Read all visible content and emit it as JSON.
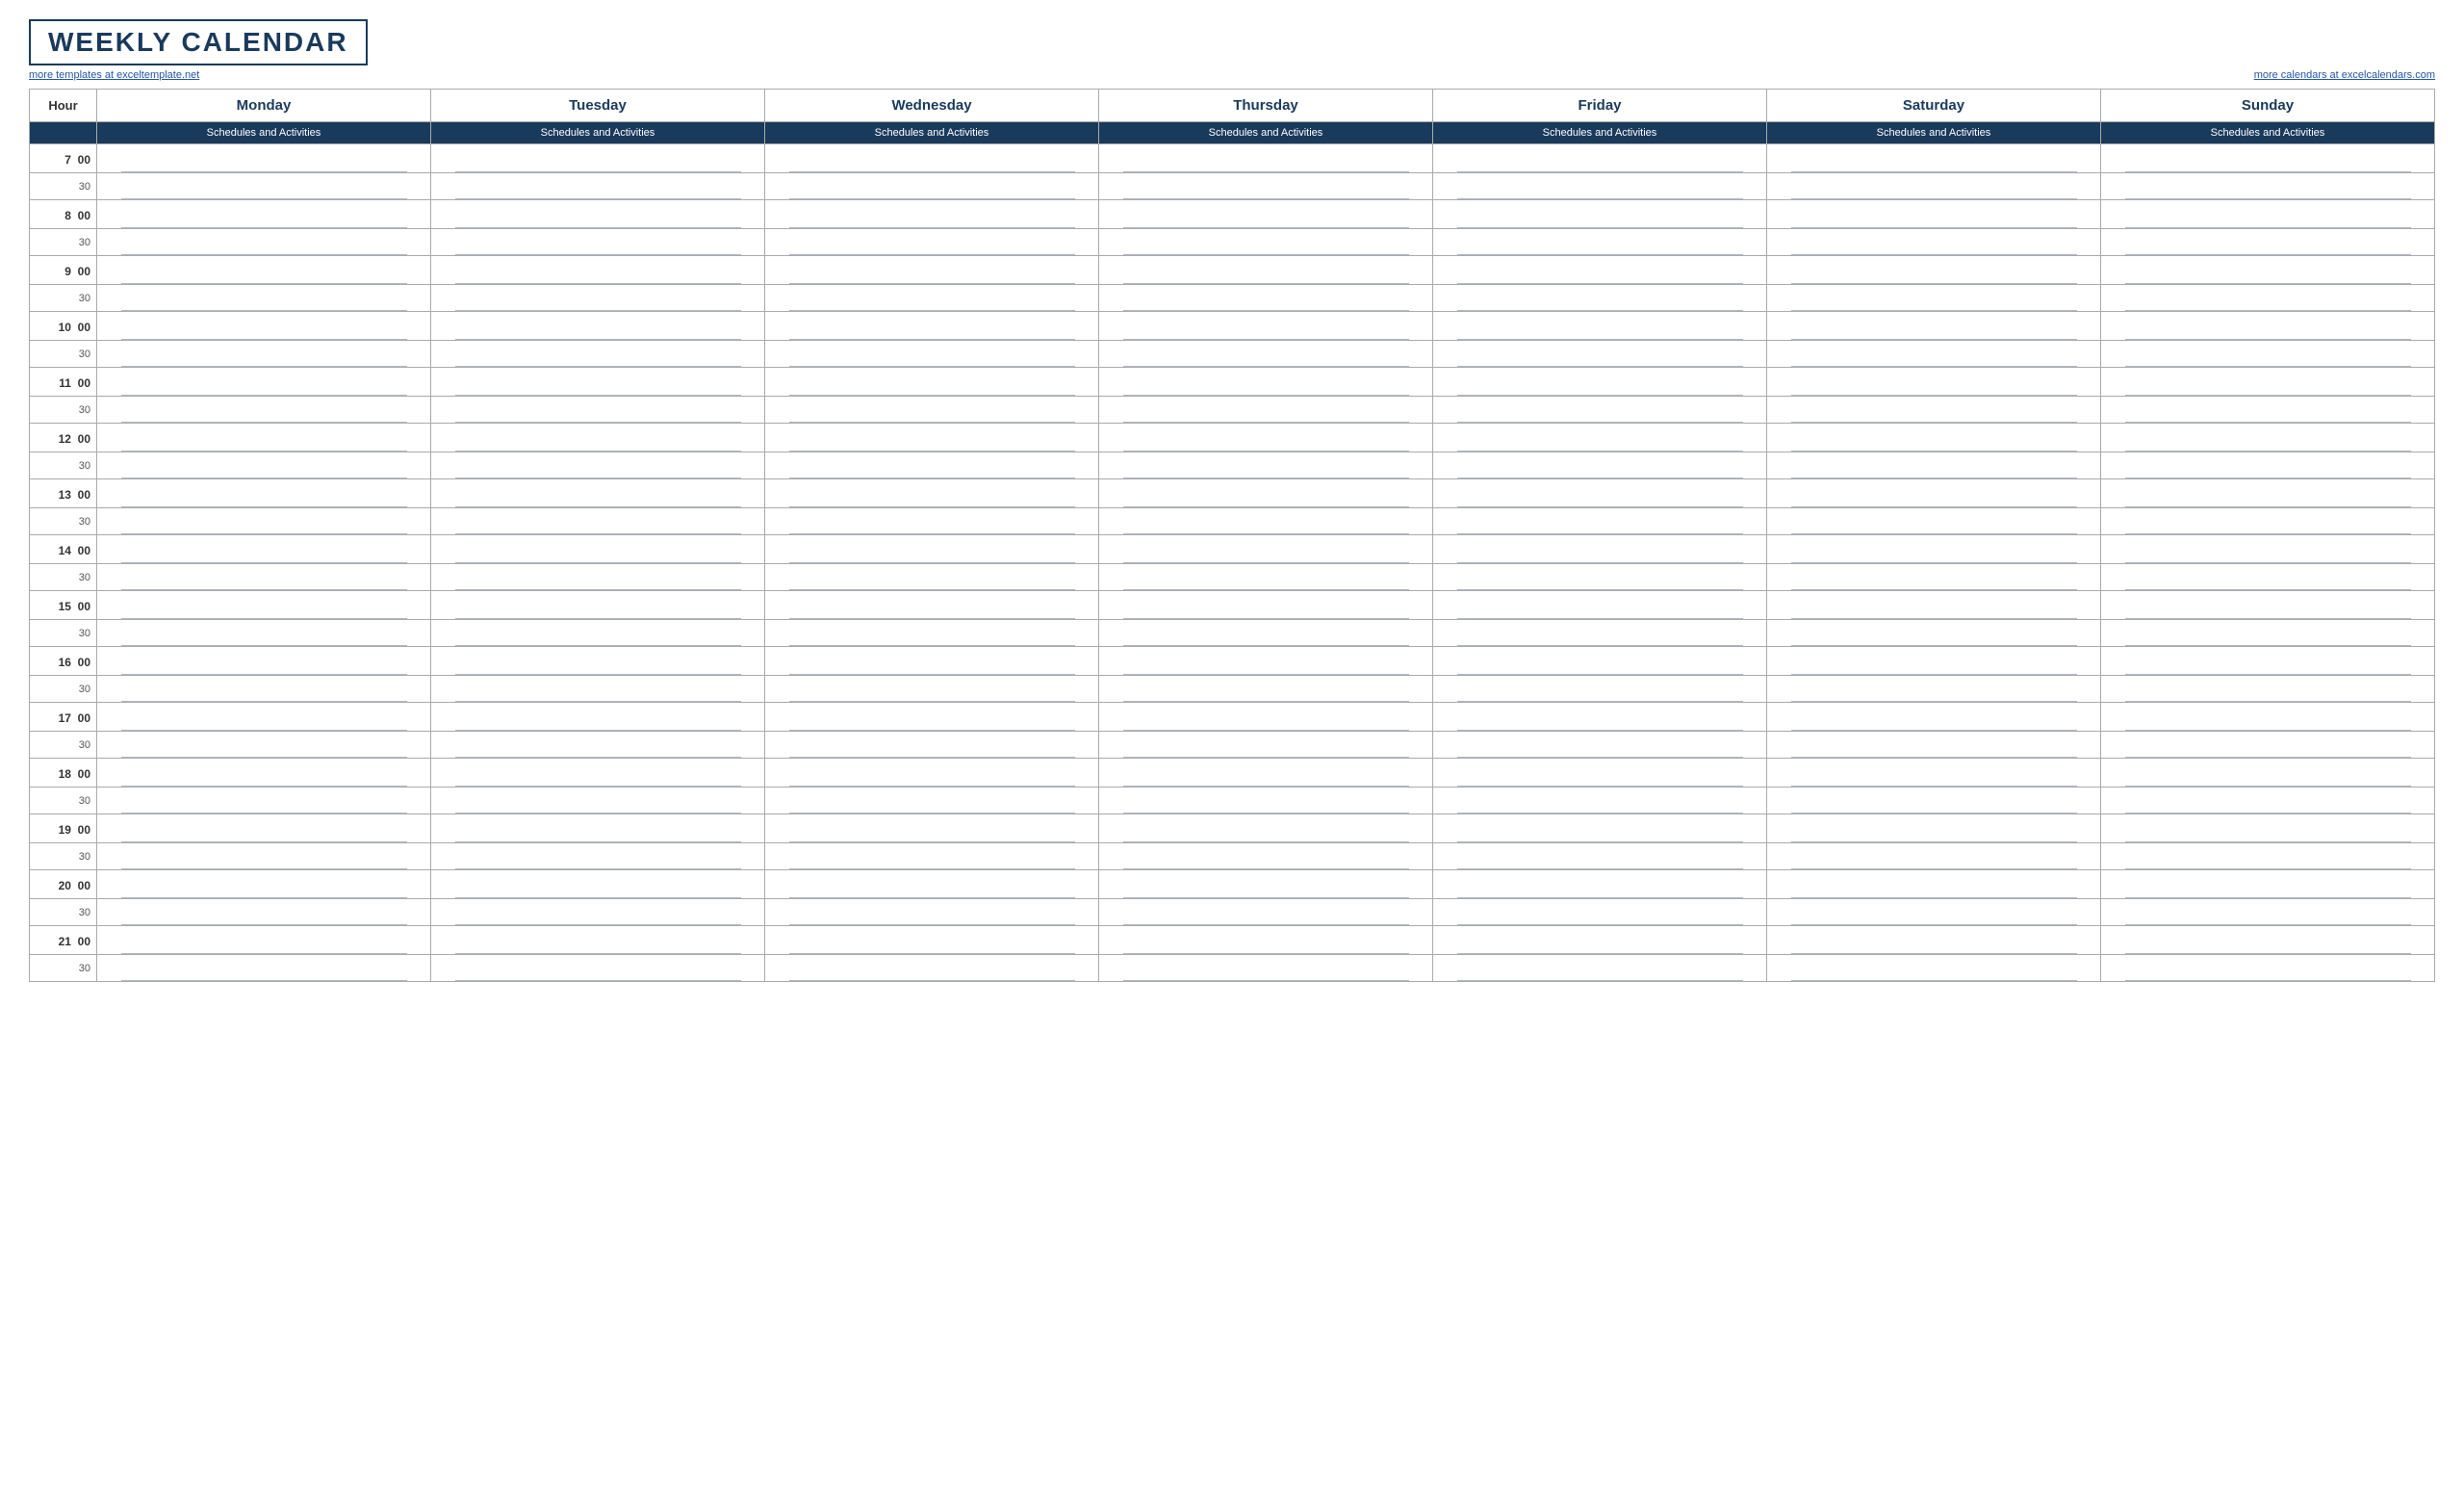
{
  "title": "WEEKLY CALENDAR",
  "subtitle_left": "more templates at exceltemplate.net",
  "subtitle_right": "more calendars at excelcalendars.com",
  "header": {
    "hour_label": "Hour",
    "days": [
      "Monday",
      "Tuesday",
      "Wednesday",
      "Thursday",
      "Friday",
      "Saturday",
      "Sunday"
    ],
    "sub_label": "Schedules and Activities"
  },
  "hours": [
    {
      "hour": "7",
      "min": "00"
    },
    {
      "hour": "",
      "min": "30"
    },
    {
      "hour": "8",
      "min": "00"
    },
    {
      "hour": "",
      "min": "30"
    },
    {
      "hour": "9",
      "min": "00"
    },
    {
      "hour": "",
      "min": "30"
    },
    {
      "hour": "10",
      "min": "00"
    },
    {
      "hour": "",
      "min": "30"
    },
    {
      "hour": "11",
      "min": "00"
    },
    {
      "hour": "",
      "min": "30"
    },
    {
      "hour": "12",
      "min": "00"
    },
    {
      "hour": "",
      "min": "30"
    },
    {
      "hour": "13",
      "min": "00"
    },
    {
      "hour": "",
      "min": "30"
    },
    {
      "hour": "14",
      "min": "00"
    },
    {
      "hour": "",
      "min": "30"
    },
    {
      "hour": "15",
      "min": "00"
    },
    {
      "hour": "",
      "min": "30"
    },
    {
      "hour": "16",
      "min": "00"
    },
    {
      "hour": "",
      "min": "30"
    },
    {
      "hour": "17",
      "min": "00"
    },
    {
      "hour": "",
      "min": "30"
    },
    {
      "hour": "18",
      "min": "00"
    },
    {
      "hour": "",
      "min": "30"
    },
    {
      "hour": "19",
      "min": "00"
    },
    {
      "hour": "",
      "min": "30"
    },
    {
      "hour": "20",
      "min": "00"
    },
    {
      "hour": "",
      "min": "30"
    },
    {
      "hour": "21",
      "min": "00"
    },
    {
      "hour": "",
      "min": "30"
    }
  ]
}
